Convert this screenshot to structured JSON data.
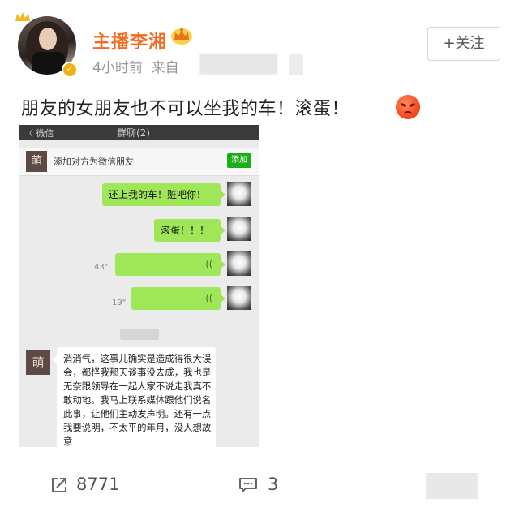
{
  "post": {
    "username": "主播李湘",
    "time": "4小时前",
    "source_prefix": "来自",
    "follow_label": "+关注",
    "text": "朋友的女朋友也不可以坐我的车！滚蛋！",
    "emoji_icon": "angry-face-icon"
  },
  "chat_screenshot": {
    "back_label": "〈 微信",
    "title": "群聊(2)",
    "add_friend_text": "添加对方为微信朋友",
    "add_button": "添加",
    "left_avatar_char": "萌",
    "messages": [
      {
        "side": "right",
        "type": "text",
        "text": "还上我的车！赃吧你！"
      },
      {
        "side": "right",
        "type": "text",
        "text": "滚蛋！！！"
      },
      {
        "side": "right",
        "type": "voice",
        "duration": "43\""
      },
      {
        "side": "right",
        "type": "voice",
        "duration": "19\""
      },
      {
        "side": "left",
        "type": "text",
        "text": "消消气，这事儿确实是造成得很大误会，都怪我那天谈事没去成，我也是无奈跟领导在一起人家不说走我真不敢动地。我马上联系媒体跟他们说名此事，让他们主动发声明。还有一点我要说明，不太平的年月，没人想故意"
      }
    ]
  },
  "footer": {
    "share_count": "8771",
    "comment_count": "3"
  },
  "colors": {
    "username": "#f36b21",
    "bubble_green": "#9fe658",
    "add_green": "#1aad19"
  }
}
